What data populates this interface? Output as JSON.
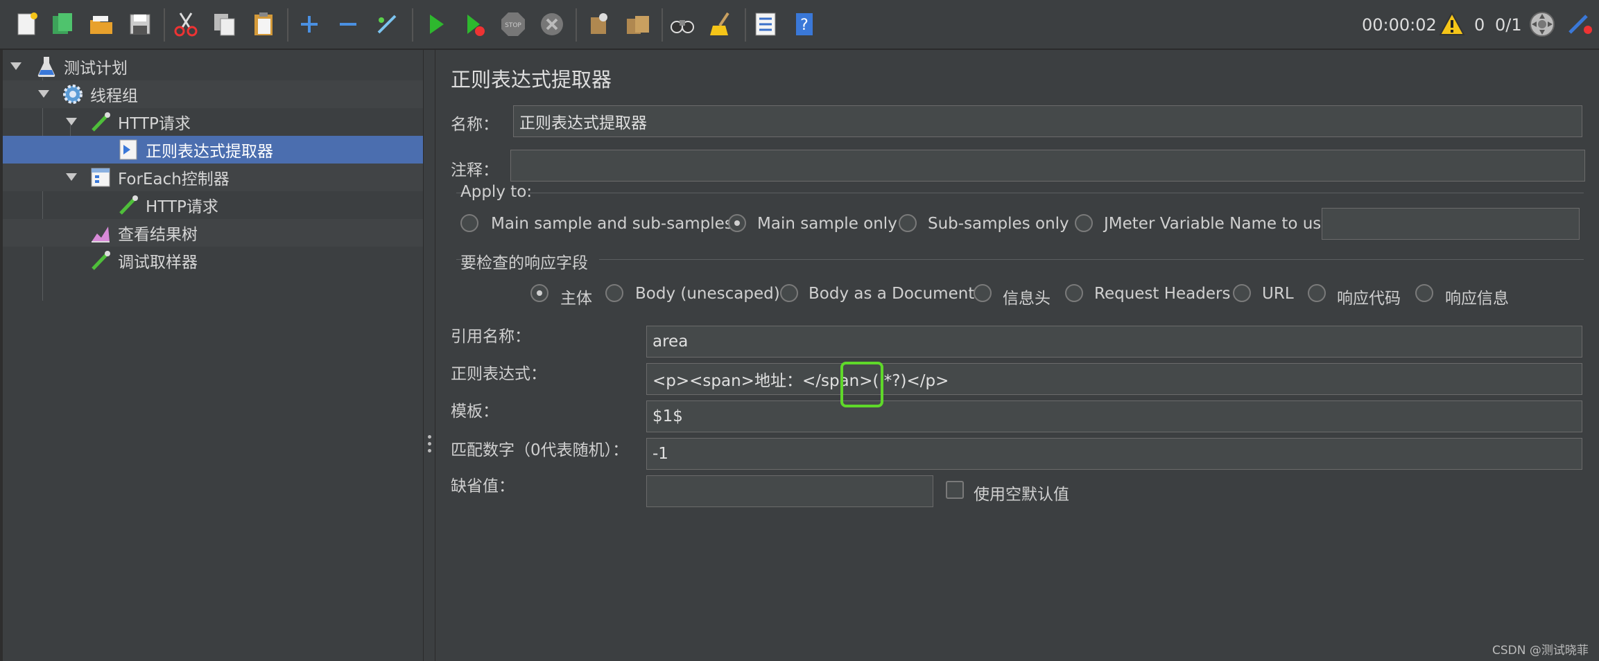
{
  "toolbar": {
    "timer": "00:00:02",
    "warning_count": "0",
    "threads": "0/1"
  },
  "tree": {
    "items": [
      {
        "label": "测试计划"
      },
      {
        "label": "线程组"
      },
      {
        "label": "HTTP请求"
      },
      {
        "label": "正则表达式提取器"
      },
      {
        "label": "ForEach控制器"
      },
      {
        "label": "HTTP请求"
      },
      {
        "label": "查看结果树"
      },
      {
        "label": "调试取样器"
      }
    ]
  },
  "panel": {
    "title": "正则表达式提取器",
    "name_label": "名称：",
    "name_value": "正则表达式提取器",
    "comment_label": "注释：",
    "comment_value": "",
    "apply_to": {
      "legend": "Apply to:",
      "options": [
        "Main sample and sub-samples",
        "Main sample only",
        "Sub-samples only",
        "JMeter Variable Name to use"
      ],
      "selected": "Main sample only",
      "variable_value": ""
    },
    "field_check": {
      "legend": "要检查的响应字段",
      "options": [
        "主体",
        "Body (unescaped)",
        "Body as a Document",
        "信息头",
        "Request Headers",
        "URL",
        "响应代码",
        "响应信息"
      ],
      "selected": "主体"
    },
    "ref_name_label": "引用名称：",
    "ref_name_value": "area",
    "regex_label": "正则表达式：",
    "regex_value": "<p><span>地址：</span>(.*?)</p>",
    "template_label": "模板：",
    "template_value": "$1$",
    "match_no_label": "匹配数字（0代表随机）：",
    "match_no_value": "-1",
    "default_label": "缺省值：",
    "default_value": "",
    "use_empty_default_label": "使用空默认值"
  },
  "watermark": "CSDN @测试晓菲",
  "colors": {
    "background": "#3c3f41",
    "selection": "#4b6eaf",
    "highlight": "#5fd82a"
  }
}
